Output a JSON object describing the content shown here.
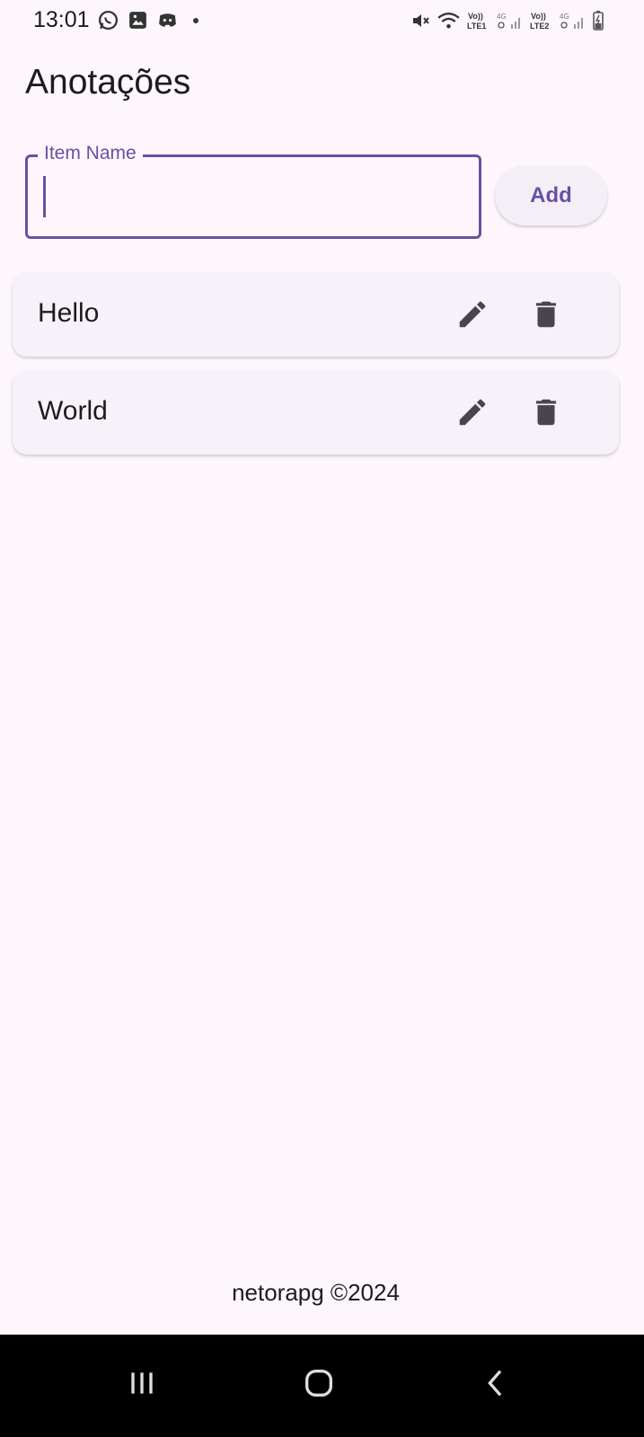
{
  "status_bar": {
    "time": "13:01",
    "notifications": [
      "whatsapp-icon",
      "image-icon",
      "discord-icon"
    ],
    "system": [
      "mute-icon",
      "wifi-icon",
      "volte-lte1-icon",
      "signal-4g-icon",
      "volte-lte2-icon",
      "signal-4g-icon",
      "battery-charging-icon"
    ]
  },
  "app": {
    "title": "Anotações"
  },
  "form": {
    "label": "Item Name",
    "value": "",
    "add_label": "Add"
  },
  "items": [
    {
      "label": "Hello"
    },
    {
      "label": "World"
    }
  ],
  "footer": {
    "text": "netorapg ©2024"
  },
  "colors": {
    "accent": "#6750a4",
    "background": "#fdf7fd",
    "card": "#f7f2f9",
    "icon": "#49454f"
  }
}
